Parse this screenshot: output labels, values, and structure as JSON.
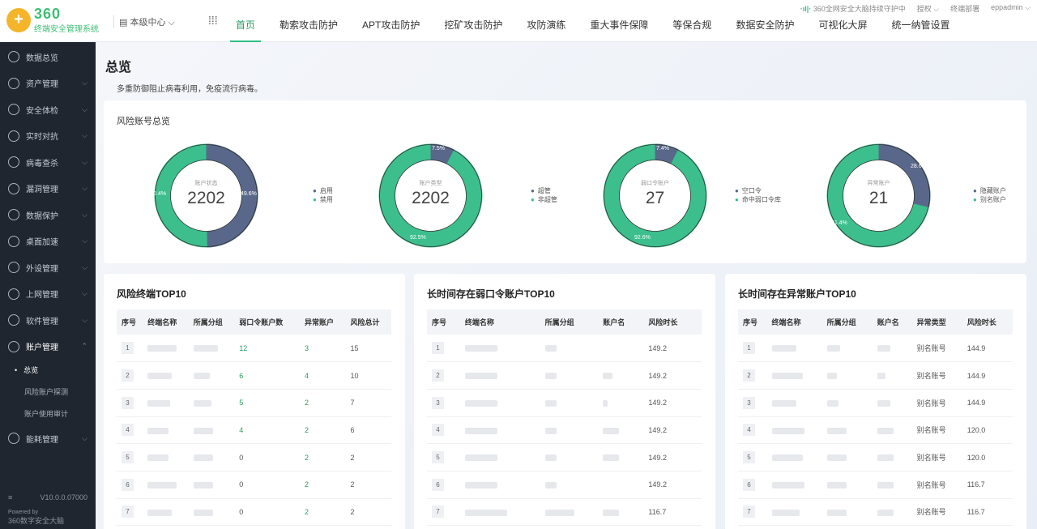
{
  "logo": {
    "brand": "360",
    "product": "终端安全管理系统"
  },
  "org": {
    "label": "本级中心"
  },
  "nav": [
    "首页",
    "勒索攻击防护",
    "APT攻击防护",
    "挖矿攻击防护",
    "攻防演练",
    "重大事件保障",
    "等保合规",
    "数据安全防护",
    "可视化大屏",
    "统一纳管设置"
  ],
  "topright": {
    "guard": "360全网安全大脑持续守护中",
    "auth": "授权",
    "deploy": "终端部署",
    "user": "eppadmin"
  },
  "sidebar": {
    "items": [
      "数据总览",
      "资产管理",
      "安全体检",
      "实时对抗",
      "病毒查杀",
      "漏洞管理",
      "数据保护",
      "桌面加速",
      "外设管理",
      "上网管理",
      "软件管理",
      "账户管理"
    ],
    "sub": [
      "总览",
      "风险账户探测",
      "账户使用审计"
    ],
    "last": "能耗管理",
    "version": "V10.0.0.07000",
    "powered": "Powered by",
    "brand": "360数字安全大脑"
  },
  "page": {
    "title": "总览",
    "desc": "多重防御阻止病毒利用，免疫流行病毒。"
  },
  "overview": {
    "title": "风险账号总览",
    "donuts": [
      {
        "label": "账户状态",
        "value": "2202",
        "pcts": [
          "0.4%",
          "49.6%"
        ],
        "legend": [
          "启用",
          "禁用"
        ]
      },
      {
        "label": "账户类型",
        "value": "2202",
        "pcts": [
          "7.5%",
          "92.5%"
        ],
        "legend": [
          "超管",
          "非超管"
        ]
      },
      {
        "label": "弱口令账户",
        "value": "27",
        "pcts": [
          "7.4%",
          "92.6%"
        ],
        "legend": [
          "空口令",
          "命中弱口令库"
        ]
      },
      {
        "label": "异常账户",
        "value": "21",
        "pcts": [
          "28.6%",
          "71.4%"
        ],
        "legend": [
          "隐藏账户",
          "别名账户"
        ]
      }
    ]
  },
  "t1": {
    "title": "风险终端TOP10",
    "headers": [
      "序号",
      "终端名称",
      "所属分组",
      "弱口令账户数",
      "异常账户",
      "风险总计"
    ],
    "rows": [
      [
        "1",
        "12",
        "3",
        "15"
      ],
      [
        "2",
        "6",
        "4",
        "10"
      ],
      [
        "3",
        "5",
        "2",
        "7"
      ],
      [
        "4",
        "4",
        "2",
        "6"
      ],
      [
        "5",
        "0",
        "2",
        "2"
      ],
      [
        "6",
        "0",
        "2",
        "2"
      ],
      [
        "7",
        "0",
        "2",
        "2"
      ]
    ]
  },
  "t2": {
    "title": "长时间存在弱口令账户TOP10",
    "headers": [
      "序号",
      "终端名称",
      "所属分组",
      "账户名",
      "风险时长"
    ],
    "rows": [
      [
        "1",
        "149.2"
      ],
      [
        "2",
        "149.2"
      ],
      [
        "3",
        "149.2"
      ],
      [
        "4",
        "149.2"
      ],
      [
        "5",
        "149.2"
      ],
      [
        "6",
        "149.2"
      ],
      [
        "7",
        "116.7"
      ]
    ]
  },
  "t3": {
    "title": "长时间存在异常账户TOP10",
    "headers": [
      "序号",
      "终端名称",
      "所属分组",
      "账户名",
      "异常类型",
      "风险时长"
    ],
    "rows": [
      [
        "1",
        "别名账号",
        "144.9"
      ],
      [
        "2",
        "别名账号",
        "144.9"
      ],
      [
        "3",
        "别名账号",
        "144.9"
      ],
      [
        "4",
        "别名账号",
        "120.0"
      ],
      [
        "5",
        "别名账号",
        "120.0"
      ],
      [
        "6",
        "别名账号",
        "116.7"
      ],
      [
        "7",
        "别名账号",
        "116.7"
      ]
    ]
  }
}
